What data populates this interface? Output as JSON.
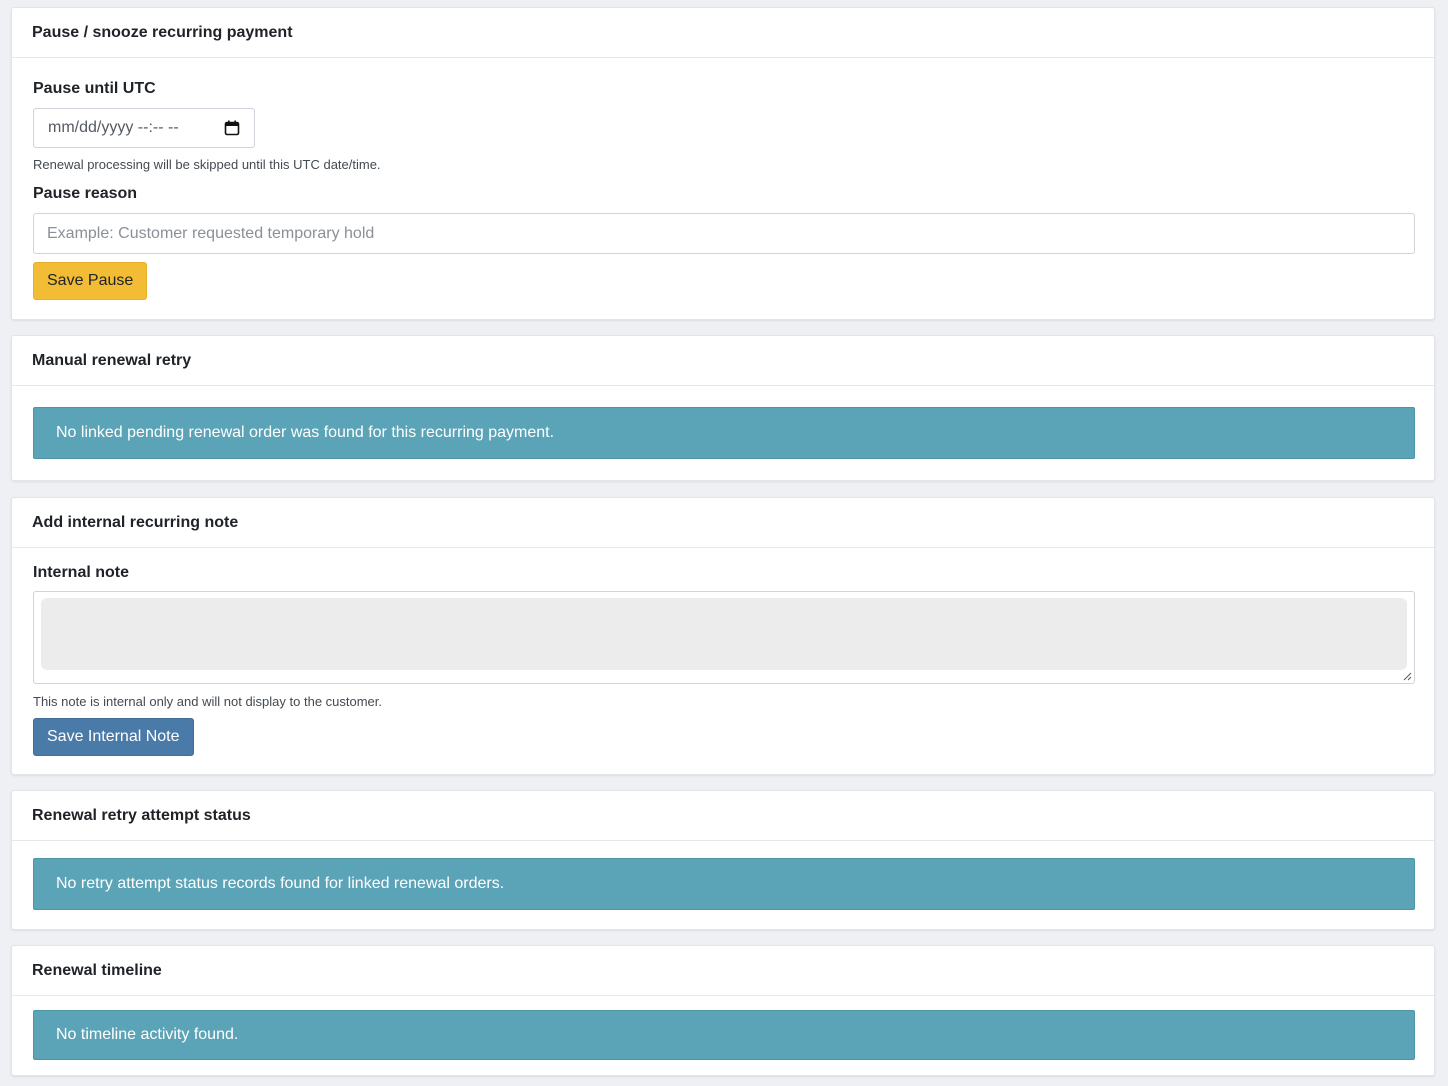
{
  "pause_card": {
    "title": "Pause / snooze recurring payment",
    "pause_until_label": "Pause until UTC",
    "date_placeholder": "mm/dd/yyyy --:-- --",
    "date_help": "Renewal processing will be skipped until this UTC date/time.",
    "pause_reason_label": "Pause reason",
    "pause_reason_placeholder": "Example: Customer requested temporary hold",
    "save_button": "Save Pause"
  },
  "manual_retry_card": {
    "title": "Manual renewal retry",
    "alert": "No linked pending renewal order was found for this recurring payment."
  },
  "internal_note_card": {
    "title": "Add internal recurring note",
    "note_label": "Internal note",
    "note_help": "This note is internal only and will not display to the customer.",
    "save_button": "Save Internal Note"
  },
  "retry_status_card": {
    "title": "Renewal retry attempt status",
    "alert": "No retry attempt status records found for linked renewal orders."
  },
  "timeline_card": {
    "title": "Renewal timeline",
    "alert": "No timeline activity found."
  },
  "colors": {
    "warning_button": "#f2bd35",
    "primary_button": "#4a7aa8",
    "info_alert": "#5ba3b7",
    "page_background": "#eef0f4"
  }
}
